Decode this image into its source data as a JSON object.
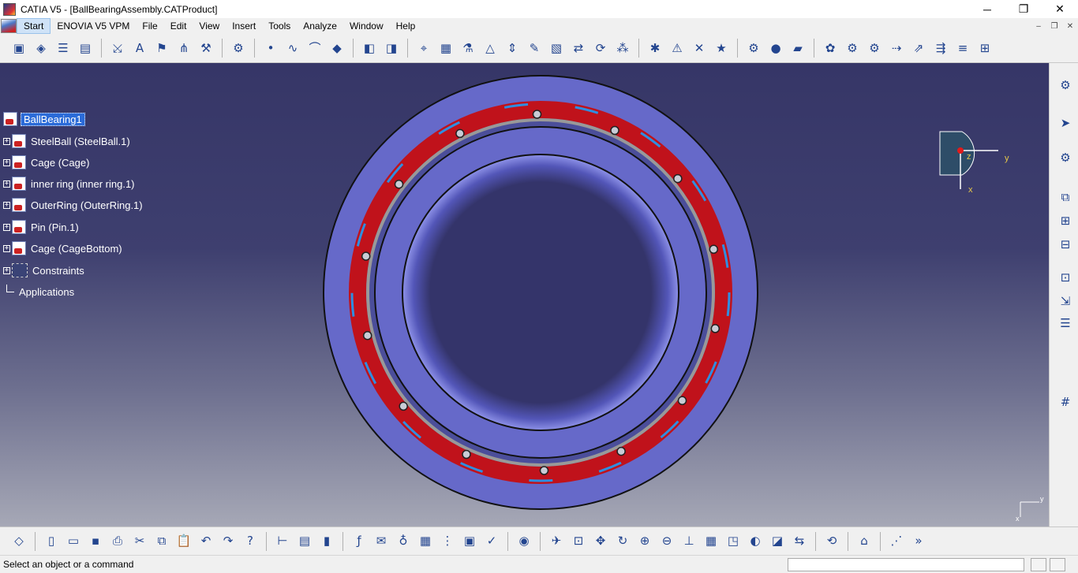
{
  "window": {
    "title": "CATIA V5 - [BallBearingAssembly.CATProduct]",
    "controls": [
      "─",
      "❐",
      "✕"
    ]
  },
  "menubar": {
    "items": [
      "Start",
      "ENOVIA V5 VPM",
      "File",
      "Edit",
      "View",
      "Insert",
      "Tools",
      "Analyze",
      "Window",
      "Help"
    ],
    "active": "Start",
    "mdi_controls": [
      "–",
      "❐",
      "✕"
    ]
  },
  "tree": {
    "root": "BallBearing1",
    "children": [
      "SteelBall (SteelBall.1)",
      "Cage (Cage)",
      "inner ring (inner ring.1)",
      "OuterRing (OuterRing.1)",
      "Pin (Pin.1)",
      "Cage (CageBottom)",
      "Constraints"
    ],
    "applications": "Applications"
  },
  "axis": {
    "x": "x",
    "y": "y",
    "z": "z"
  },
  "compass": {
    "x": "x",
    "y": "y"
  },
  "status": {
    "message": "Select an object or a command",
    "command_value": ""
  },
  "colors": {
    "viewport_top": "#363667",
    "viewport_bottom": "#a6a8b6",
    "ring": "#6669c9",
    "cage": "#c0121b",
    "selection": "#2b6bd8"
  },
  "toolbars": {
    "top": [
      "product-icon",
      "part-icon",
      "bom-icon",
      "catalog-icon",
      "sep",
      "split-icon",
      "abc-text-icon",
      "flag-note-icon",
      "weld-icon",
      "tools-icon",
      "sep",
      "conn-icon",
      "sep",
      "point-icon",
      "spline-icon",
      "arc-icon",
      "snap-icon",
      "sep",
      "view-front-icon",
      "view-iso-icon",
      "sep",
      "measure-icon",
      "box-icon",
      "assembly-icon",
      "constraint-icon",
      "align-icon",
      "pen-icon",
      "section-icon",
      "swap-icon",
      "refresh-icon",
      "scatter-icon",
      "sep",
      "explode-icon",
      "clash-icon",
      "fix-icon",
      "star-icon",
      "sep",
      "gear-analysis-icon",
      "sphere-icon",
      "graph-icon",
      "sep",
      "parts-icon",
      "gear-icon",
      "gear2-icon",
      "replace-icon",
      "publish-icon",
      "nav-icon",
      "stack-icon",
      "table-icon"
    ],
    "bottom": [
      "eraser-icon",
      "sep",
      "new-icon",
      "open-icon",
      "save-icon",
      "print-icon",
      "cut-icon",
      "copy-icon",
      "paste-icon",
      "undo-icon",
      "redo-icon",
      "whats-this-icon",
      "sep",
      "ruler-icon",
      "product-tools-icon",
      "cylinder-icon",
      "sep",
      "formula-icon",
      "comment-icon",
      "knowledge-icon",
      "calculator-icon",
      "tree-icon",
      "lock-icon",
      "check-icon",
      "sep",
      "camera-icon",
      "sep",
      "fly-icon",
      "fit-all-icon",
      "pan-icon",
      "rotate-icon",
      "zoom-in-icon",
      "zoom-out-icon",
      "normal-view-icon",
      "views-icon",
      "render-icon",
      "shading-icon",
      "hide-show-icon",
      "swap-space-icon",
      "sep",
      "cycle-icon",
      "sep",
      "bulk-icon",
      "sep",
      "tool-off-icon",
      "more-icon"
    ],
    "right": [
      "gears-icon",
      "cursor-icon",
      "select-multi-icon",
      "copy-assembly-icon",
      "new-comp-icon",
      "new-part-icon",
      "insert-comp-icon",
      "exploded-icon",
      "bom-list-icon",
      "grid-icon"
    ]
  }
}
